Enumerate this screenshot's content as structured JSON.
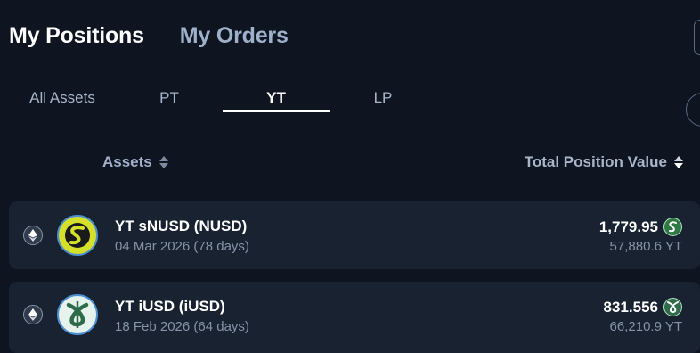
{
  "header": {
    "tabs": [
      {
        "label": "My Positions",
        "active": true
      },
      {
        "label": "My Orders",
        "active": false
      }
    ]
  },
  "sub_tabs": [
    {
      "label": "All Assets",
      "active": false
    },
    {
      "label": "PT",
      "active": false
    },
    {
      "label": "YT",
      "active": true
    },
    {
      "label": "LP",
      "active": false
    }
  ],
  "columns": {
    "assets": "Assets",
    "total_value": "Total Position Value"
  },
  "rows": [
    {
      "chain_icon": "ethereum-icon",
      "token_icon": "snusd-token-icon",
      "name": "YT sNUSD (NUSD)",
      "date": "04 Mar 2026 (78 days)",
      "value": "1,779.95",
      "amount": "57,880.6 YT",
      "accent": "#d4e02a"
    },
    {
      "chain_icon": "ethereum-icon",
      "token_icon": "iusd-token-icon",
      "name": "YT iUSD (iUSD)",
      "date": "18 Feb 2026 (64 days)",
      "value": "831.556",
      "amount": "66,210.9 YT",
      "accent": "#2e6b4a"
    }
  ],
  "colors": {
    "background": "#0e1521",
    "row_background": "#182231",
    "inactive_text": "#9fb0ca",
    "muted_text": "#8593a8"
  }
}
